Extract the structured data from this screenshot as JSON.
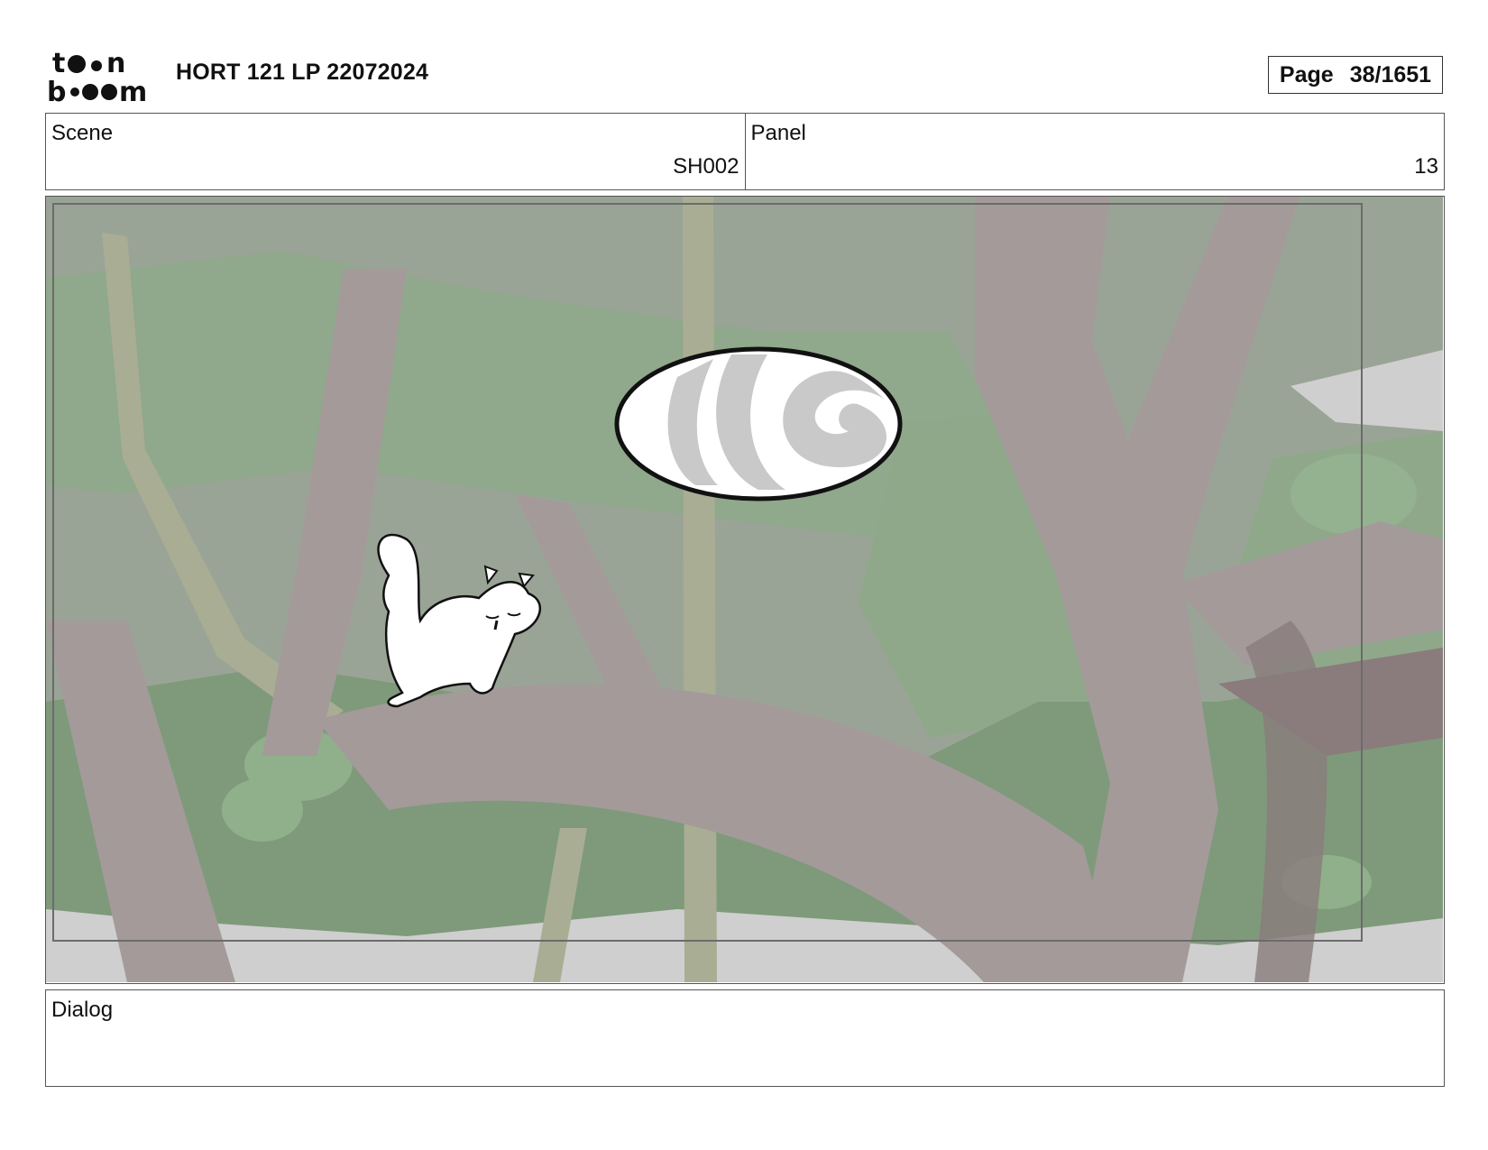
{
  "header": {
    "logo": {
      "icon": "toon-boom-logo",
      "top_word": "toon",
      "bottom_word": "boom"
    },
    "project_title": "HORT 121 LP 22072024",
    "page": {
      "label": "Page",
      "value": "38/1651"
    }
  },
  "info": {
    "scene": {
      "label": "Scene",
      "value": "SH002"
    },
    "panel": {
      "label": "Panel",
      "value": "13"
    }
  },
  "panel_image": {
    "description_icon": "storyboard-panel-image",
    "elements": [
      "forest-background",
      "swirl-portal",
      "squirrel-character"
    ]
  },
  "dialog": {
    "label": "Dialog",
    "text": ""
  },
  "colors": {
    "sky": "#9aa496",
    "foliage": "#8fa88a",
    "foliage_dark": "#6f8f6c",
    "trunk": "#a49a9a",
    "trunk_dark": "#8a7c7c",
    "vine": "#a9ad94",
    "ground_gap": "#cfcfcf"
  }
}
